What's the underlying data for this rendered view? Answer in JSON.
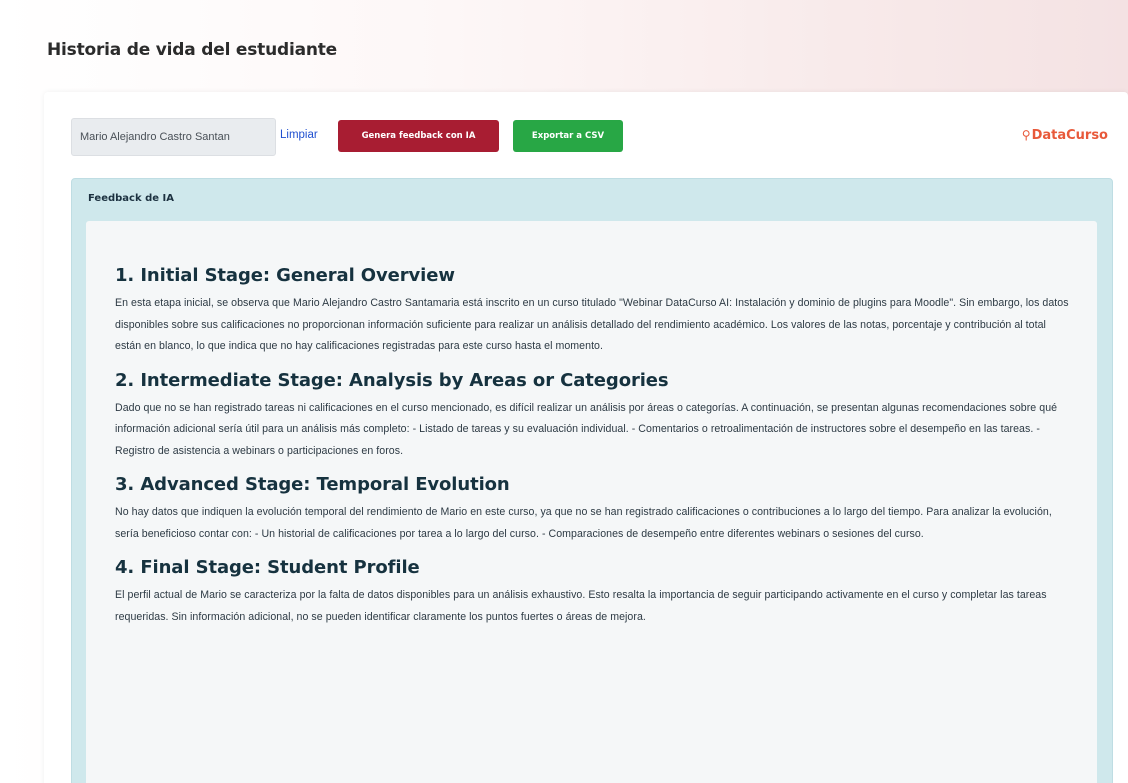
{
  "page": {
    "title": "Historia de vida del estudiante"
  },
  "toolbar": {
    "search_value": "Mario Alejandro Castro Santan",
    "clear_label": "Limpiar",
    "ai_button_label": "Genera feedback con IA",
    "csv_button_label": "Exportar a CSV",
    "logo_text": "DataCurso",
    "logo_icon": "lightbulb-icon"
  },
  "colors": {
    "ai_button": "#a81d32",
    "csv_button": "#28a745",
    "logo": "#e8593a",
    "feedback_panel": "#cfe8ec"
  },
  "feedback": {
    "title": "Feedback de IA",
    "sections": [
      {
        "heading": "1. Initial Stage: General Overview",
        "text": "En esta etapa inicial, se observa que Mario Alejandro Castro Santamaria está inscrito en un curso titulado \"Webinar DataCurso AI: Instalación y dominio de plugins para Moodle\". Sin embargo, los datos disponibles sobre sus calificaciones no proporcionan información suficiente para realizar un análisis detallado del rendimiento académico. Los valores de las notas, porcentaje y contribución al total están en blanco, lo que indica que no hay calificaciones registradas para este curso hasta el momento."
      },
      {
        "heading": "2. Intermediate Stage: Analysis by Areas or Categories",
        "text": "Dado que no se han registrado tareas ni calificaciones en el curso mencionado, es difícil realizar un análisis por áreas o categorías. A continuación, se presentan algunas recomendaciones sobre qué información adicional sería útil para un análisis más completo: - Listado de tareas y su evaluación individual. - Comentarios o retroalimentación de instructores sobre el desempeño en las tareas. - Registro de asistencia a webinars o participaciones en foros."
      },
      {
        "heading": "3. Advanced Stage: Temporal Evolution",
        "text": "No hay datos que indiquen la evolución temporal del rendimiento de Mario en este curso, ya que no se han registrado calificaciones o contribuciones a lo largo del tiempo. Para analizar la evolución, sería beneficioso contar con: - Un historial de calificaciones por tarea a lo largo del curso. - Comparaciones de desempeño entre diferentes webinars o sesiones del curso."
      },
      {
        "heading": "4. Final Stage: Student Profile",
        "text": "El perfil actual de Mario se caracteriza por la falta de datos disponibles para un análisis exhaustivo. Esto resalta la importancia de seguir participando activamente en el curso y completar las tareas requeridas. Sin información adicional, no se pueden identificar claramente los puntos fuertes o áreas de mejora."
      }
    ]
  }
}
